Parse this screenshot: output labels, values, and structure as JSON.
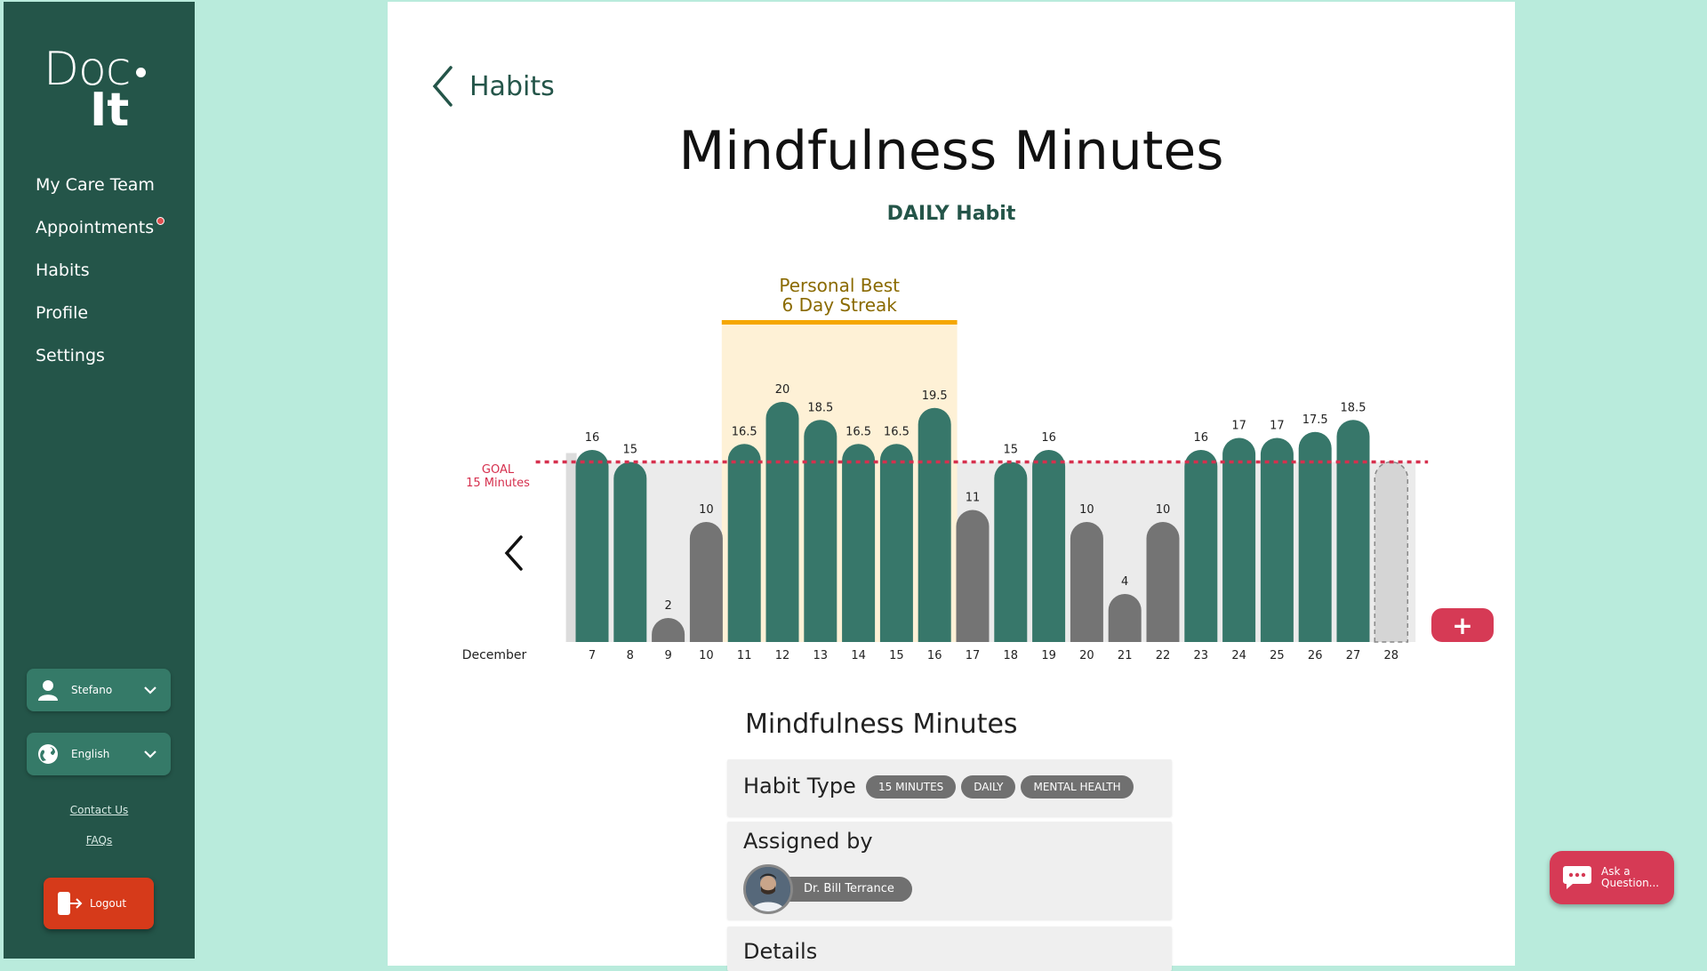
{
  "app": {
    "logo_line1": "Doc",
    "logo_line2": "It"
  },
  "sidebar": {
    "items": [
      {
        "label": "My Care Team"
      },
      {
        "label": "Appointments",
        "notification": true
      },
      {
        "label": "Habits"
      },
      {
        "label": "Profile"
      },
      {
        "label": "Settings"
      }
    ],
    "user_label": "Stefano",
    "language_label": "English",
    "contact_label": "Contact Us",
    "faqs_label": "FAQs",
    "logout_label": "Logout"
  },
  "header": {
    "back_label": "Habits",
    "title": "Mindfulness Minutes",
    "subtitle": "DAILY Habit"
  },
  "chart_data": {
    "type": "bar",
    "x_label": "December",
    "categories": [
      "7",
      "8",
      "9",
      "10",
      "11",
      "12",
      "13",
      "14",
      "15",
      "16",
      "17",
      "18",
      "19",
      "20",
      "21",
      "22",
      "23",
      "24",
      "25",
      "26",
      "27",
      "28"
    ],
    "values": [
      16,
      15,
      2,
      10,
      16.5,
      20,
      18.5,
      16.5,
      16.5,
      19.5,
      11,
      15,
      16,
      10,
      4,
      10,
      16,
      17,
      17,
      17.5,
      18.5,
      null
    ],
    "goal": 15,
    "goal_label_1": "GOAL",
    "goal_label_2": "15 Minutes",
    "streak_title_1": "Personal Best",
    "streak_title_2": "6 Day Streak",
    "streak_range": [
      "11",
      "16"
    ],
    "colors": {
      "met": "#37776a",
      "missed": "#747474",
      "streak_bg": "#fef1d6",
      "streak_line": "#f5a700",
      "goal": "#d6304e",
      "future": "#d5d5d5"
    }
  },
  "details": {
    "section_title": "Mindfulness Minutes",
    "habit_type_label": "Habit Type",
    "tags": [
      "15 MINUTES",
      "DAILY",
      "MENTAL HEALTH"
    ],
    "assigned_label": "Assigned by",
    "doctor_name": "Dr. Bill Terrance",
    "details_label": "Details"
  },
  "ask": {
    "label": "Ask a Question..."
  }
}
